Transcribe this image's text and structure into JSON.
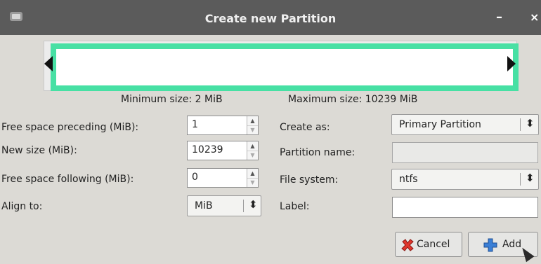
{
  "window": {
    "title": "Create new Partition",
    "minimize_glyph": "–",
    "close_glyph": "×"
  },
  "partition_visual": {
    "min_size_label": "Minimum size: 2 MiB",
    "max_size_label": "Maximum size: 10239 MiB"
  },
  "left_form": {
    "free_preceding": {
      "label": "Free space preceding (MiB):",
      "value": "1"
    },
    "new_size": {
      "label": "New size (MiB):",
      "value": "10239"
    },
    "free_following": {
      "label": "Free space following (MiB):",
      "value": "0"
    },
    "align_to": {
      "label": "Align to:",
      "value": "MiB"
    }
  },
  "right_form": {
    "create_as": {
      "label": "Create as:",
      "value": "Primary Partition"
    },
    "partition_name": {
      "label": "Partition name:",
      "value": ""
    },
    "file_system": {
      "label": "File system:",
      "value": "ntfs"
    },
    "label_field": {
      "label": "Label:",
      "value": ""
    }
  },
  "buttons": {
    "cancel": {
      "label": "Cancel",
      "icon": "red-x-icon"
    },
    "add": {
      "label": "Add",
      "icon": "blue-plus-icon"
    }
  },
  "colors": {
    "titlebar": "#5b5b5b",
    "partition_border": "#47e0a4",
    "dialog_bg": "#dcdad5"
  }
}
